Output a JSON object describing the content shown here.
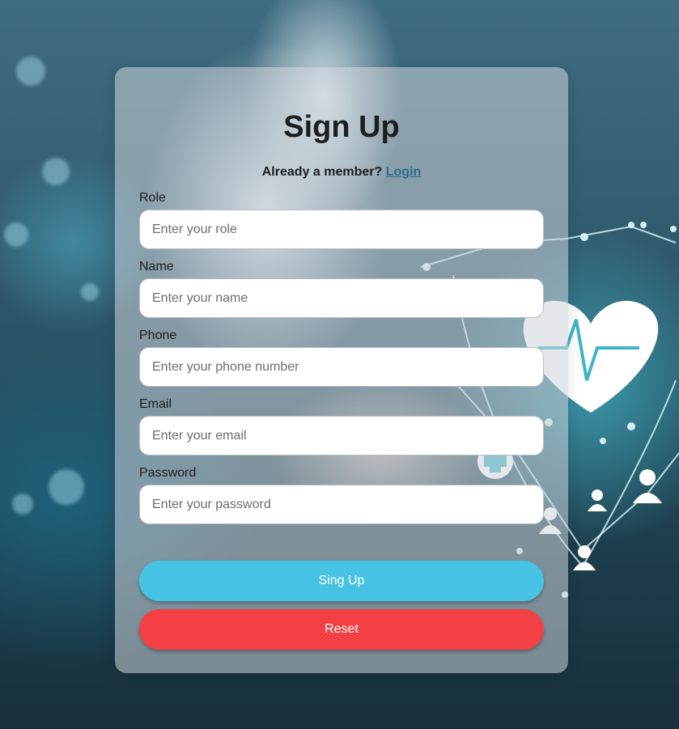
{
  "form": {
    "title": "Sign Up",
    "member_prompt": "Already a member?",
    "login_link": "Login",
    "fields": [
      {
        "label": "Role",
        "placeholder": "Enter your role",
        "value": ""
      },
      {
        "label": "Name",
        "placeholder": "Enter your name",
        "value": ""
      },
      {
        "label": "Phone",
        "placeholder": "Enter your phone number",
        "value": ""
      },
      {
        "label": "Email",
        "placeholder": "Enter your email",
        "value": ""
      },
      {
        "label": "Password",
        "placeholder": "Enter your password",
        "value": ""
      }
    ],
    "signup_button": "Sing Up",
    "reset_button": "Reset"
  },
  "colors": {
    "signup_button": "#46c3e3",
    "reset_button": "#f34044",
    "link": "#2e6d8c",
    "card": "rgba(205,212,218,0.55)"
  },
  "background": {
    "icons": [
      "heart-pulse-icon",
      "medical-cross-icon",
      "person-icon"
    ]
  }
}
